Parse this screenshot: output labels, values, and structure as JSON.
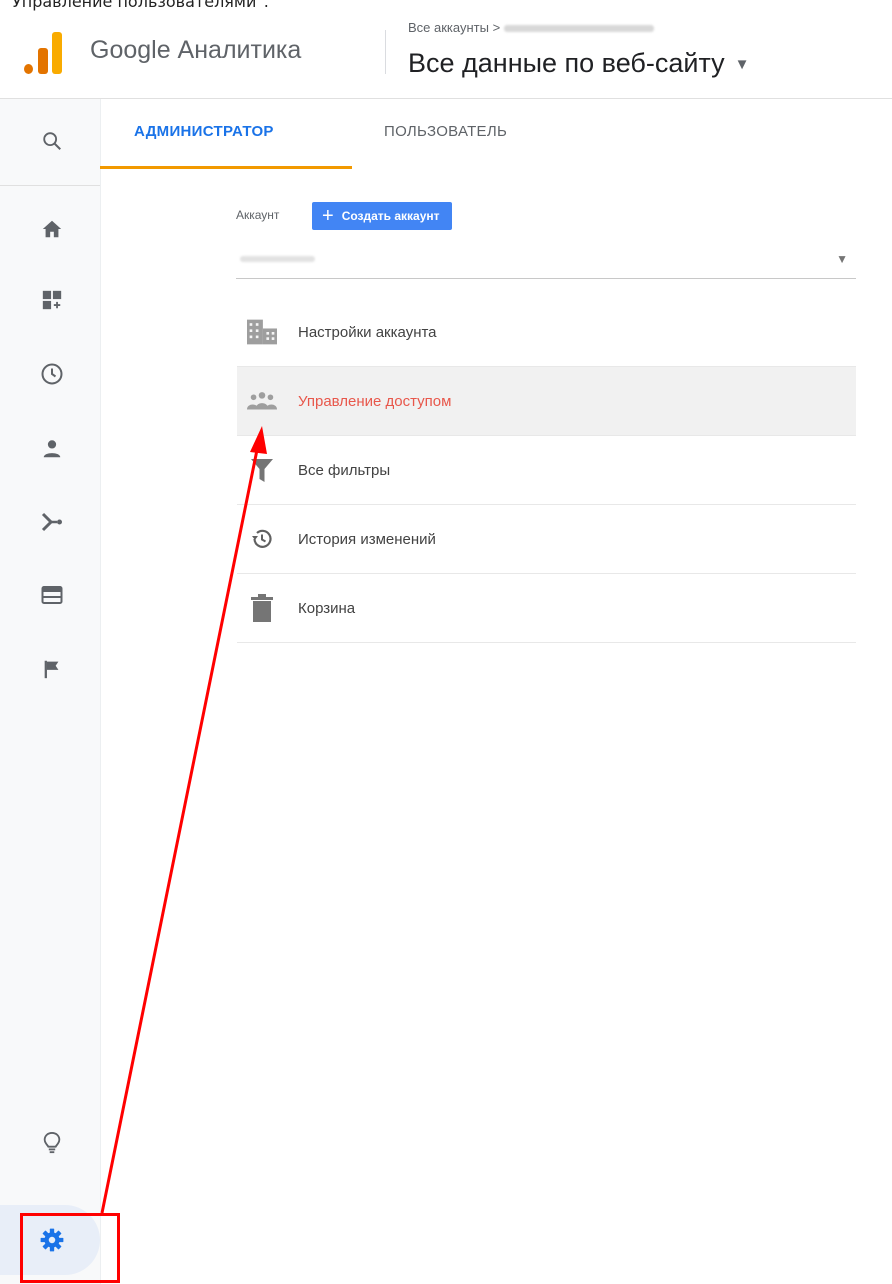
{
  "caption": "Управление пользователями\".",
  "header": {
    "product_name": "Google Аналитика",
    "breadcrumb": "Все аккаунты >",
    "view_name": "Все данные по веб-сайту",
    "logo_colors": [
      "#f9ab00",
      "#e37400",
      "#e37400"
    ]
  },
  "tabs": {
    "admin": "АДМИНИСТРАТОР",
    "user": "ПОЛЬЗОВАТЕЛЬ",
    "active_color": "#1a73e8",
    "underline_color": "#f29900"
  },
  "account": {
    "label": "Аккаунт",
    "create_button": "Создать аккаунт",
    "button_color": "#4285f4"
  },
  "menu": {
    "items": [
      {
        "label": "Настройки аккаунта",
        "icon": "building-icon"
      },
      {
        "label": "Управление доступом",
        "icon": "people-icon"
      },
      {
        "label": "Все фильтры",
        "icon": "filter-icon"
      },
      {
        "label": "История изменений",
        "icon": "history-icon"
      },
      {
        "label": "Корзина",
        "icon": "trash-icon"
      }
    ],
    "active_color": "#e8574b"
  },
  "leftnav": {
    "icons": [
      "search-icon",
      "home-icon",
      "customization-icon",
      "realtime-icon",
      "audience-icon",
      "acquisition-icon",
      "behavior-icon",
      "conversions-icon",
      "discover-icon",
      "admin-gear-icon"
    ],
    "icon_color": "#5f6368",
    "gear_color": "#1a73e8"
  },
  "annotation": {
    "color": "#ff0000"
  }
}
